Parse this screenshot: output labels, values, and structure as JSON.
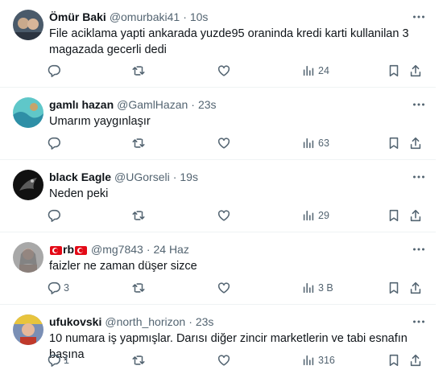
{
  "tweets": [
    {
      "name": "Ömür Baki",
      "handle": "@omurbaki41",
      "time": "10s",
      "text": "File aciklama yapti ankarada yuzde95 oraninda kredi karti kullanilan 3 magazada gecerli dedi",
      "replies": "",
      "retweets": "",
      "likes": "",
      "views": "24",
      "avatar_colors": [
        "#4a5a6a",
        "#c9a98c"
      ]
    },
    {
      "name": "gamlı hazan",
      "handle": "@GamlHazan",
      "time": "23s",
      "text": "Umarım yaygınlaşır",
      "replies": "",
      "retweets": "",
      "likes": "",
      "views": "63",
      "avatar_colors": [
        "#5fc7c9",
        "#2e8fa6"
      ]
    },
    {
      "name": "black Eagle",
      "handle": "@UGorseli",
      "time": "19s",
      "text": "Neden peki",
      "replies": "",
      "retweets": "",
      "likes": "",
      "views": "29",
      "avatar_colors": [
        "#111111",
        "#5b5b5b"
      ]
    },
    {
      "name_part": "rb",
      "handle": "@mg7843",
      "time": "24 Haz",
      "text": "faizler ne zaman düşer sizce",
      "replies": "3",
      "retweets": "",
      "likes": "",
      "views": "3 B",
      "avatar_colors": [
        "#a8a8a8",
        "#d2b0a0"
      ]
    },
    {
      "name": "ufukovski",
      "handle": "@north_horizon",
      "time": "23s",
      "text": "10 numara iş yapmışlar. Darısı diğer zincir marketlerin ve tabi esnafın başına",
      "replies": "1",
      "retweets": "",
      "likes": "",
      "views": "316",
      "avatar_colors": [
        "#e8c43d",
        "#7a8fb5"
      ]
    }
  ],
  "dot": "·",
  "icons": {
    "reply": "reply-icon",
    "retweet": "retweet-icon",
    "like": "heart-icon",
    "views": "views-chart-icon",
    "bookmark": "bookmark-icon",
    "share": "share-icon",
    "more": "more-dots-icon"
  }
}
